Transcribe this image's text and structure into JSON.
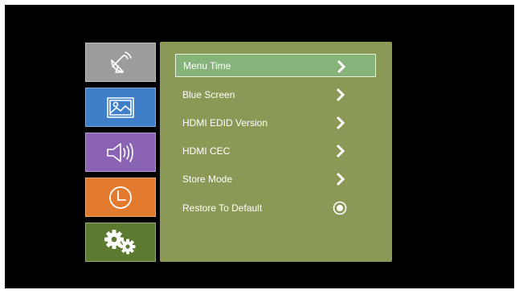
{
  "colors": {
    "screen_bg": "#000000",
    "panel_bg": "#8a9a56",
    "selected_bg": "#86b379",
    "selected_border": "#e8f2df",
    "cat_channel": "#9c9c9c",
    "cat_picture": "#3f7fca",
    "cat_sound": "#8a63b4",
    "cat_time": "#e27a2d",
    "cat_setup": "#5c7a30",
    "text": "#ffffff"
  },
  "sidebar": {
    "categories": [
      {
        "name": "channel",
        "icon": "satellite-dish-icon"
      },
      {
        "name": "picture",
        "icon": "picture-icon"
      },
      {
        "name": "sound",
        "icon": "speaker-icon"
      },
      {
        "name": "time",
        "icon": "clock-icon"
      },
      {
        "name": "setup",
        "icon": "gears-icon",
        "active": true
      }
    ]
  },
  "menu": {
    "items": [
      {
        "label": "Menu Time",
        "control": "chevron-right-icon",
        "selected": true
      },
      {
        "label": "Blue Screen",
        "control": "chevron-right-icon"
      },
      {
        "label": "HDMI EDID Version",
        "control": "chevron-right-icon"
      },
      {
        "label": "HDMI CEC",
        "control": "chevron-right-icon"
      },
      {
        "label": "Store Mode",
        "control": "chevron-right-icon"
      },
      {
        "label": "Restore To Default",
        "control": "radio-icon"
      }
    ]
  }
}
